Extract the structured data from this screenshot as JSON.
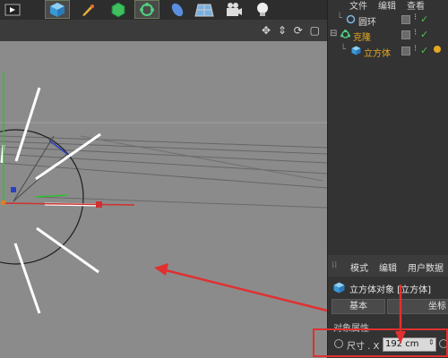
{
  "toolbar": {
    "tools": [
      {
        "icon": "render-icon",
        "selected": false
      },
      {
        "icon": "cube-icon",
        "selected": true
      },
      {
        "icon": "pen-icon",
        "selected": false
      },
      {
        "icon": "subdivision-icon",
        "selected": false
      },
      {
        "icon": "array-icon",
        "selected": true
      },
      {
        "icon": "deformer-icon",
        "selected": false
      },
      {
        "icon": "floor-icon",
        "selected": false
      },
      {
        "icon": "camera-icon",
        "selected": false
      },
      {
        "icon": "light-icon",
        "selected": false
      }
    ]
  },
  "object_manager": {
    "menu": [
      "文件",
      "编辑",
      "查看"
    ],
    "objects": [
      {
        "name": "圆环",
        "color": "#dcdcdc",
        "icon": "circle-icon"
      },
      {
        "name": "克隆",
        "color": "#e6a820",
        "icon": "cloner-icon"
      },
      {
        "name": "立方体",
        "color": "#e6a820",
        "icon": "cube-icon"
      }
    ]
  },
  "attributes": {
    "tabs": [
      "模式",
      "编辑",
      "用户数据"
    ],
    "object_title": "立方体对象 [立方体]",
    "buttons": [
      "基本",
      "坐标"
    ],
    "section": "对象属性",
    "size_label": "尺寸 . X",
    "size_value": "192 cm"
  },
  "colors": {
    "highlight": "#e03030",
    "selected_orange": "#e6a820",
    "check_green": "#4cc64c"
  }
}
